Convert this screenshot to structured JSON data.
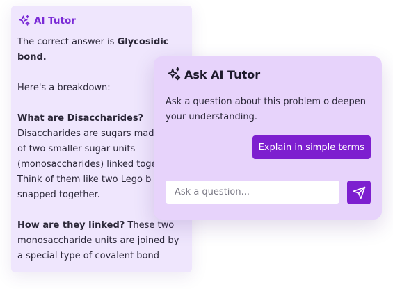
{
  "background_card": {
    "title": "AI Tutor",
    "intro_prefix": "The correct answer is ",
    "intro_answer": "Glycosidic bond.",
    "breakdown": "Here's a breakdown:",
    "section1_heading": "What are Disaccharides?",
    "section1_lines": [
      "Disaccharides are sugars mad",
      "of two smaller sugar units",
      "(monosaccharides) linked toge",
      "Think of them like two Lego b",
      "snapped together."
    ],
    "section2_heading": "How are they linked?",
    "section2_first": " These two",
    "section2_lines": [
      "monosaccharide units are joined by",
      "a special type of covalent bond"
    ],
    "icon": "sparkles-icon"
  },
  "ask_card": {
    "title": "Ask AI Tutor",
    "description_lines": [
      "Ask a question about this problem o deepen",
      "your understanding."
    ],
    "explain_button": "Explain in simple terms",
    "input_placeholder": "Ask a question...",
    "send_icon": "send-icon",
    "icon": "sparkles-icon"
  },
  "colors": {
    "accent": "#7d1fcf",
    "back_card_bg": "#efe6fd",
    "front_card_bg": "#e7d3fb",
    "header_purple": "#7a2bd6"
  }
}
